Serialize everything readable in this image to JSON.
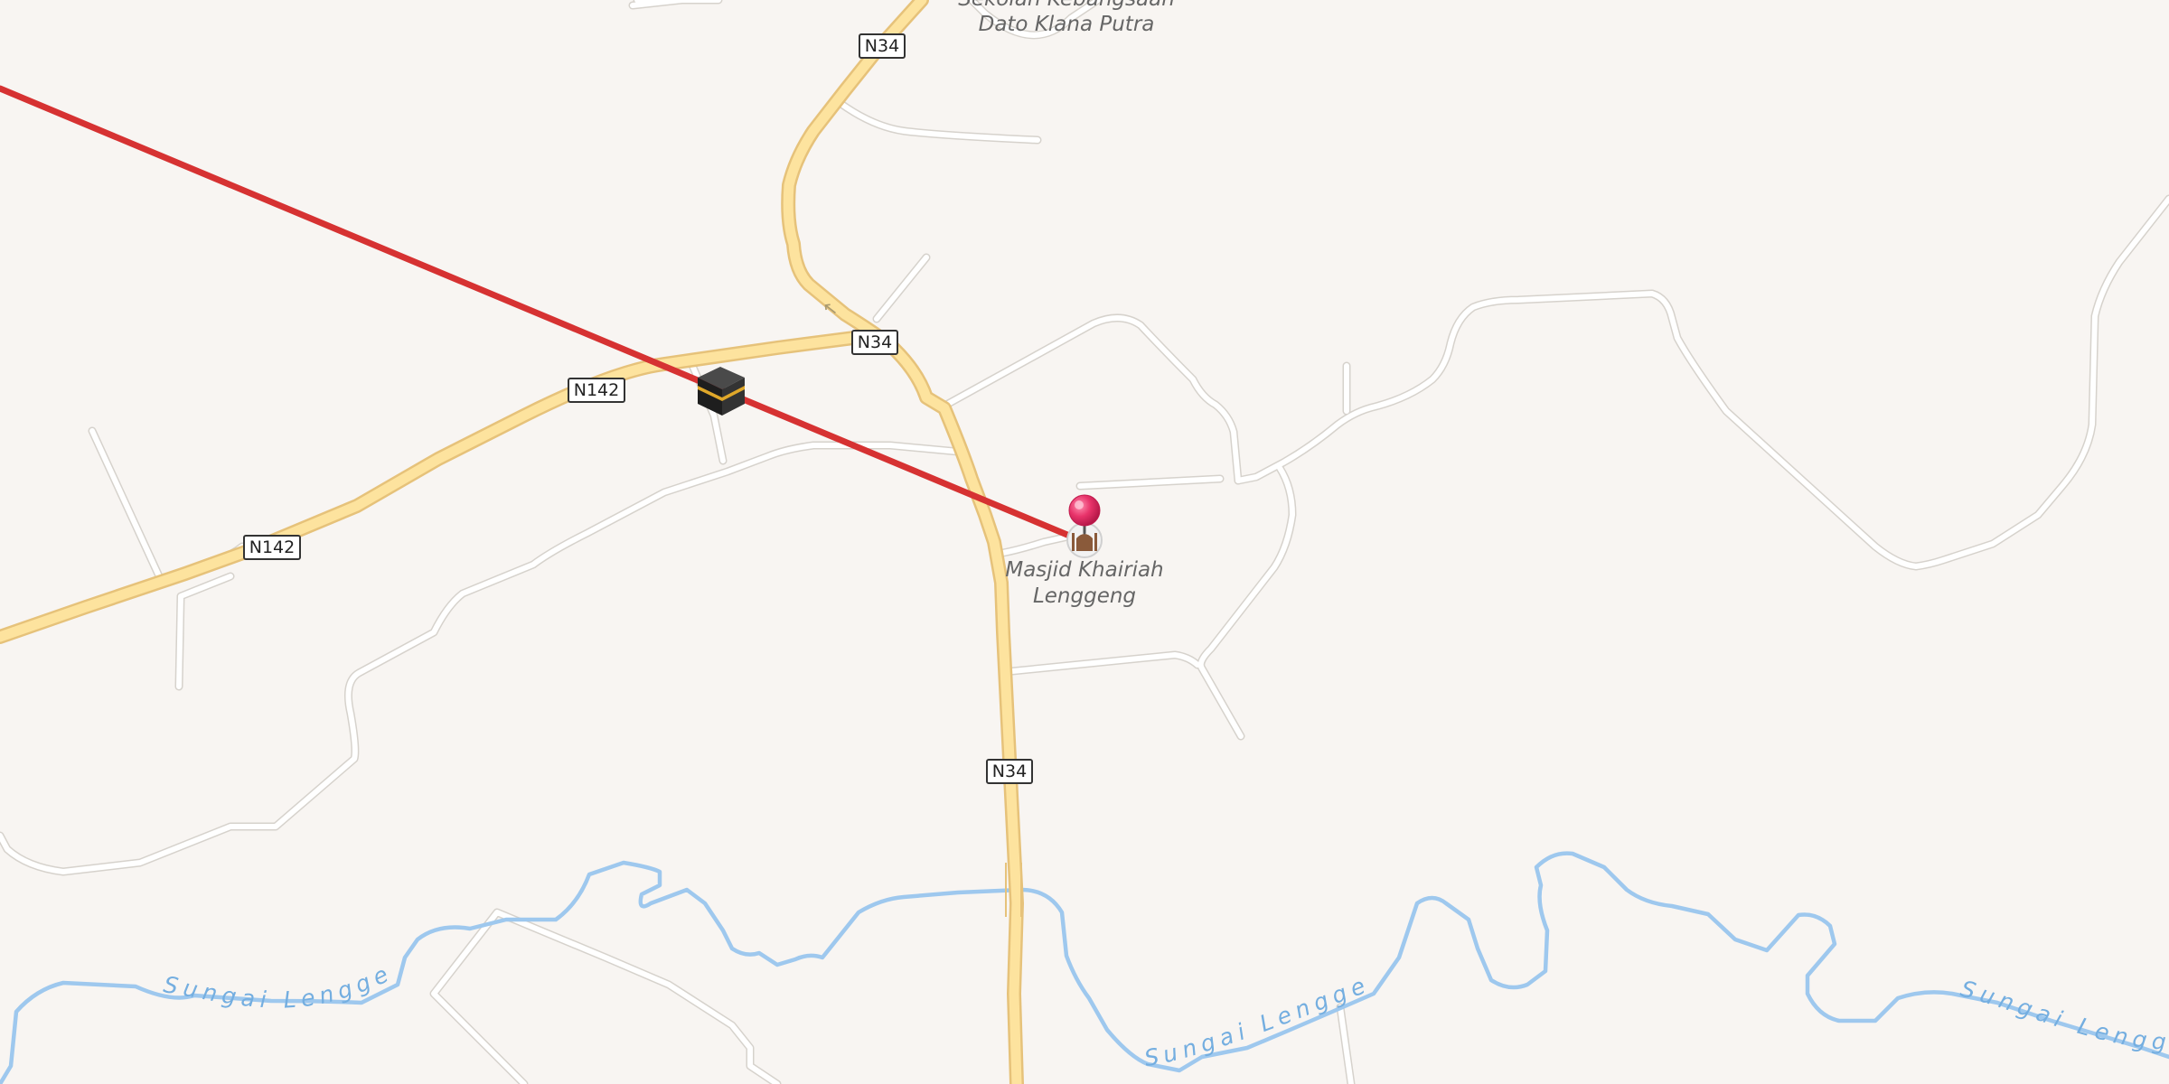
{
  "map": {
    "road_shields": [
      {
        "id": "n34-top",
        "label": "N34"
      },
      {
        "id": "n34-mid",
        "label": "N34"
      },
      {
        "id": "n34-bottom",
        "label": "N34"
      },
      {
        "id": "n142-upper",
        "label": "N142"
      },
      {
        "id": "n142-lower",
        "label": "N142"
      }
    ],
    "places": {
      "school_line1": "Sekolah Kebangsaan",
      "school_line2": "Dato Klana Putra",
      "mosque_line1": "Masjid Khairiah",
      "mosque_line2": "Lenggeng"
    },
    "rivers": [
      {
        "id": "river-left",
        "label": "Sungai Lenggeng"
      },
      {
        "id": "river-center",
        "label": "Sungai Lenggeng"
      },
      {
        "id": "river-right",
        "label": "Sungai Lenggeng"
      }
    ],
    "icons": {
      "kaaba": "kaaba-icon",
      "mosque": "mosque-icon",
      "pin": "location-pin-icon"
    },
    "colors": {
      "background": "#f8f5f2",
      "main_road": "#fde39e",
      "river": "#9ec8ee",
      "qibla_line": "#d63232",
      "pin": "#e8336a"
    }
  }
}
